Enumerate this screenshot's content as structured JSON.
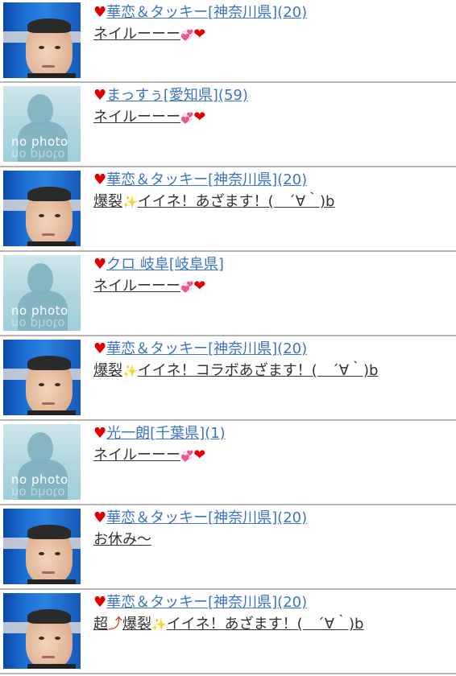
{
  "colors": {
    "link": "#3d73c4",
    "heart": "#e00000",
    "divider": "#b5b5b5",
    "message": "#333333"
  },
  "avatar_labels": {
    "no_photo": "no photo"
  },
  "rows": [
    {
      "avatar": "photo",
      "name": "華恋＆タッキー[神奈川県](20)",
      "msg": [
        {
          "t": "ネイルーーー"
        },
        {
          "e": "💞",
          "n": "hearts-icon"
        },
        {
          "e": "❤",
          "n": "heart-icon"
        }
      ]
    },
    {
      "avatar": "no-photo",
      "name": "まっすぅ[愛知県](59)",
      "msg": [
        {
          "t": "ネイルーーー"
        },
        {
          "e": "💞",
          "n": "hearts-icon"
        },
        {
          "e": "❤",
          "n": "heart-icon"
        }
      ]
    },
    {
      "avatar": "photo",
      "name": "華恋＆タッキー[神奈川県](20)",
      "msg": [
        {
          "t": "爆裂"
        },
        {
          "e": "✨",
          "n": "sparkle-icon"
        },
        {
          "t": "イイネ！あざます！(　´∀｀)b"
        }
      ]
    },
    {
      "avatar": "no-photo",
      "name": "クロ 岐阜[岐阜県]",
      "msg": [
        {
          "t": "ネイルーーー"
        },
        {
          "e": "💞",
          "n": "hearts-icon"
        },
        {
          "e": "❤",
          "n": "heart-icon"
        }
      ]
    },
    {
      "avatar": "photo",
      "name": "華恋＆タッキー[神奈川県](20)",
      "msg": [
        {
          "t": "爆裂"
        },
        {
          "e": "✨",
          "n": "sparkle-icon"
        },
        {
          "t": "イイネ！コラボあざます！(　´∀｀)b"
        }
      ]
    },
    {
      "avatar": "no-photo",
      "name": "光一朗[千葉県](1)",
      "msg": [
        {
          "t": "ネイルーーー"
        },
        {
          "e": "💞",
          "n": "hearts-icon"
        },
        {
          "e": "❤",
          "n": "heart-icon"
        }
      ]
    },
    {
      "avatar": "photo",
      "name": "華恋＆タッキー[神奈川県](20)",
      "msg": [
        {
          "t": "お休み〜"
        }
      ]
    },
    {
      "avatar": "photo",
      "name": "華恋＆タッキー[神奈川県](20)",
      "msg": [
        {
          "t": "超"
        },
        {
          "e": "⤴",
          "n": "up-arrow-icon"
        },
        {
          "t": "爆裂"
        },
        {
          "e": "✨",
          "n": "sparkle-icon"
        },
        {
          "t": "イイネ！あざます！(　´∀｀)b"
        }
      ]
    }
  ]
}
